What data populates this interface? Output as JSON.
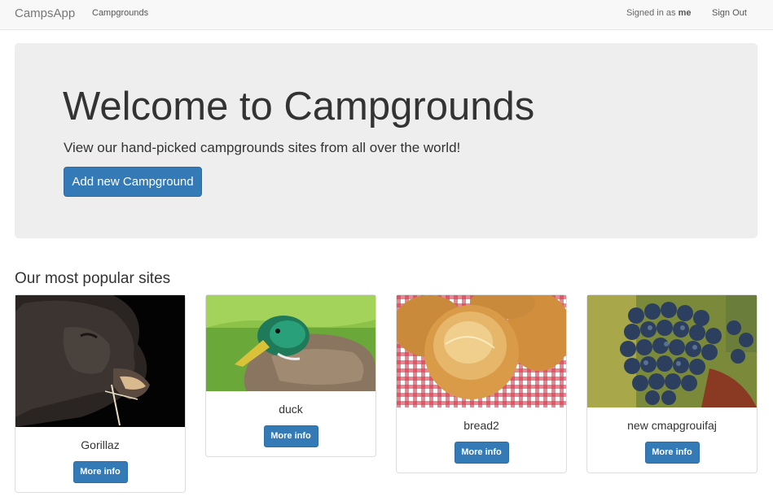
{
  "navbar": {
    "brand": "CampsApp",
    "campgrounds_link": "Campgrounds",
    "signed_in_prefix": "Signed in as",
    "signed_in_user": "me",
    "sign_out": "Sign Out"
  },
  "jumbotron": {
    "title": "Welcome to Campgrounds",
    "lead": "View our hand-picked campgrounds sites from all over the world!",
    "add_button": "Add new Campground"
  },
  "section": {
    "title": "Our most popular sites"
  },
  "cards": [
    {
      "name": "Gorillaz",
      "button": "More info",
      "image": "gorilla-photo"
    },
    {
      "name": "duck",
      "button": "More info",
      "image": "duck-photo"
    },
    {
      "name": "bread2",
      "button": "More info",
      "image": "bread-photo"
    },
    {
      "name": "new cmapgrouifaj",
      "button": "More info",
      "image": "grapes-photo"
    }
  ]
}
